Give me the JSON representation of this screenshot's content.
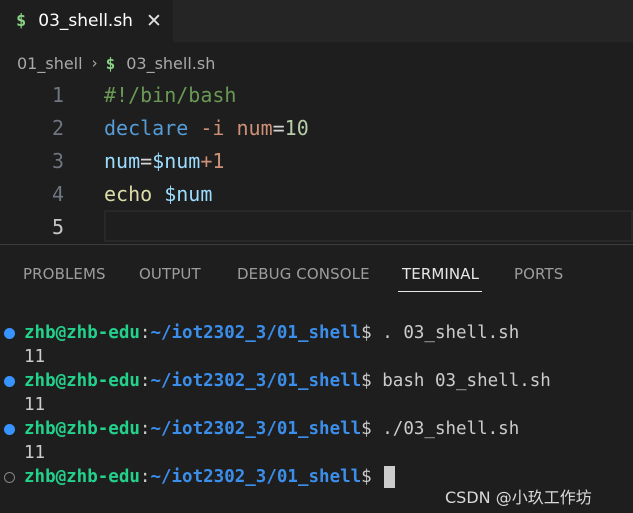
{
  "tab": {
    "icon": "$",
    "title": "03_shell.sh",
    "close": "✕"
  },
  "breadcrumb": {
    "folder": "01_shell",
    "separator": "›",
    "file_icon": "$",
    "file": "03_shell.sh"
  },
  "editor": {
    "lines": [
      {
        "number": "1",
        "tokens": [
          {
            "t": "#!/bin/bash",
            "c": "comment"
          }
        ]
      },
      {
        "number": "2",
        "tokens": [
          {
            "t": "declare",
            "c": "kw"
          },
          {
            "t": " ",
            "c": "op"
          },
          {
            "t": "-i",
            "c": "flag"
          },
          {
            "t": " ",
            "c": "op"
          },
          {
            "t": "num",
            "c": "flag"
          },
          {
            "t": "=",
            "c": "op"
          },
          {
            "t": "10",
            "c": "num"
          }
        ]
      },
      {
        "number": "3",
        "tokens": [
          {
            "t": "num",
            "c": "var"
          },
          {
            "t": "=",
            "c": "op"
          },
          {
            "t": "$num",
            "c": "var"
          },
          {
            "t": "+1",
            "c": "plus"
          }
        ]
      },
      {
        "number": "4",
        "tokens": [
          {
            "t": "echo",
            "c": "cmd"
          },
          {
            "t": " ",
            "c": "op"
          },
          {
            "t": "$num",
            "c": "var"
          }
        ]
      },
      {
        "number": "5",
        "tokens": []
      }
    ]
  },
  "panel": {
    "tabs": [
      "PROBLEMS",
      "OUTPUT",
      "DEBUG CONSOLE",
      "TERMINAL",
      "PORTS"
    ],
    "active_tab": "TERMINAL"
  },
  "terminal": {
    "user": "zhb@zhb-edu",
    "colon": ":",
    "path": "~/iot2302_3/01_shell",
    "sign": "$",
    "entries": [
      {
        "command": ". 03_shell.sh",
        "output": "11"
      },
      {
        "command": "bash 03_shell.sh",
        "output": "11"
      },
      {
        "command": "./03_shell.sh",
        "output": "11"
      }
    ]
  },
  "watermark": "CSDN @小玖工作坊",
  "colors": {
    "accent_blue": "#3794ff",
    "user_green": "#23d18b",
    "path_blue": "#3b8eea",
    "background": "#1e1e1e"
  },
  "icons": {
    "tab_icon": "shell-dollar-icon",
    "close": "close-icon",
    "chevron": "chevron-right-icon",
    "terminal_dot": "command-decoration-icon"
  }
}
